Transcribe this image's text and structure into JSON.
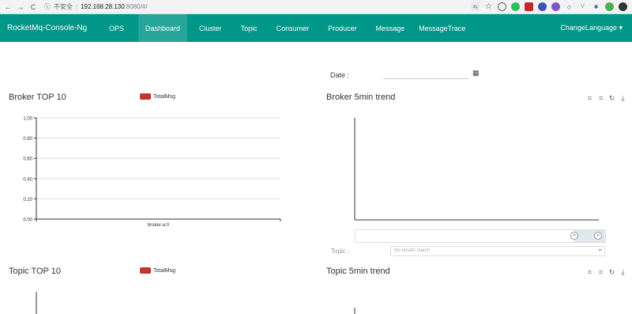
{
  "browser": {
    "back": "←",
    "forward": "→",
    "reload": "C",
    "security": "不安全",
    "host": "192.168.28.130",
    "path": ":8080/#/"
  },
  "nav": {
    "brand": "RocketMq-Console-Ng",
    "items": [
      {
        "label": "OPS",
        "active": false
      },
      {
        "label": "Dashboard",
        "active": true
      },
      {
        "label": "Cluster",
        "active": false
      },
      {
        "label": "Topic",
        "active": false
      },
      {
        "label": "Consumer",
        "active": false
      },
      {
        "label": "Producer",
        "active": false
      },
      {
        "label": "Message",
        "active": false
      },
      {
        "label": "MessageTrace",
        "active": false
      }
    ],
    "language": "ChangeLanguage ▾"
  },
  "date": {
    "label": "Date :",
    "value": "",
    "icon": "calendar-icon"
  },
  "broker_top": {
    "title": "Broker TOP 10",
    "legend": "TotalMsg"
  },
  "broker_trend": {
    "title": "Broker 5min trend"
  },
  "topic_filter": {
    "label": "Topic :",
    "placeholder": "No results match"
  },
  "topic_top": {
    "title": "Topic TOP 10",
    "legend": "TotalMsg"
  },
  "topic_trend": {
    "title": "Topic 5min trend"
  },
  "colors": {
    "nav_bg": "#009688",
    "nav_active": "#26a69a",
    "series": "#c23531"
  },
  "chart_data": [
    {
      "type": "bar",
      "title": "Broker TOP 10",
      "categories": [
        "broker-a:0"
      ],
      "series": [
        {
          "name": "TotalMsg",
          "values": [
            0
          ]
        }
      ],
      "yticks": [
        "1.00",
        "0.80",
        "0.60",
        "0.40",
        "0.20",
        "0.00"
      ],
      "ylim": [
        0,
        1
      ],
      "grid": true,
      "legend": "top-center"
    },
    {
      "type": "line",
      "title": "Broker 5min trend",
      "series": []
    },
    {
      "type": "bar",
      "title": "Topic TOP 10",
      "legend": "top-center",
      "series": [
        {
          "name": "TotalMsg",
          "values": []
        }
      ]
    },
    {
      "type": "line",
      "title": "Topic 5min trend",
      "series": []
    }
  ]
}
